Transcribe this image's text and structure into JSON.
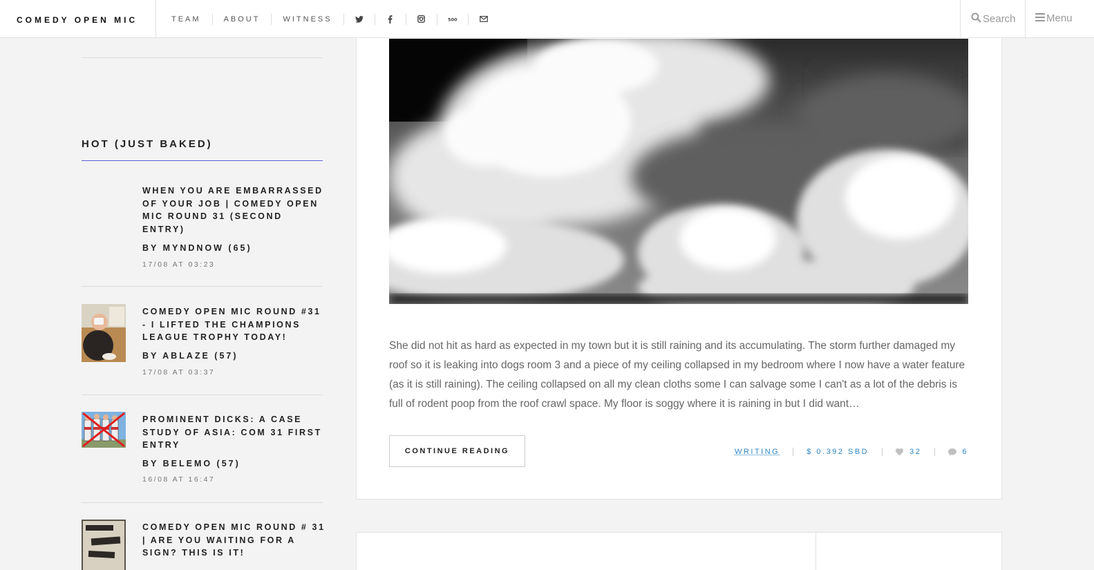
{
  "header": {
    "brand": "COMEDY OPEN MIC",
    "nav": [
      {
        "label": "TEAM"
      },
      {
        "label": "ABOUT"
      },
      {
        "label": "WITNESS"
      }
    ],
    "social_icons": [
      "twitter-icon",
      "facebook-icon",
      "instagram-icon",
      "500px-icon",
      "email-icon"
    ],
    "search_label": "Search",
    "menu_label": "Menu"
  },
  "sidebar": {
    "section_title": "HOT (JUST BAKED)",
    "accent_color": "#5b5fd6",
    "posts": [
      {
        "title": "WHEN YOU ARE EMBARRASSED OF YOUR JOB | COMEDY OPEN MIC ROUND 31 (SECOND ENTRY)",
        "author": "BY MYNDNOW (65)",
        "date": "17/08 AT 03:23",
        "has_thumb": false
      },
      {
        "title": "COMEDY OPEN MIC ROUND #31 - I LIFTED THE CHAMPIONS LEAGUE TROPHY TODAY!",
        "author": "BY ABLAZE (57)",
        "date": "17/08 AT 03:37",
        "has_thumb": true
      },
      {
        "title": "PROMINENT DICKS: A CASE STUDY OF ASIA: COM 31 FIRST ENTRY",
        "author": "BY BELEMO (57)",
        "date": "16/08 AT 16:47",
        "has_thumb": true
      },
      {
        "title": "COMEDY OPEN MIC ROUND # 31 | ARE YOU WAITING FOR A SIGN? THIS IS IT!",
        "author": "",
        "date": "",
        "has_thumb": true
      }
    ]
  },
  "article": {
    "excerpt": "She did not hit as hard as expected in my town but it is still raining and its accumulating. The storm further damaged my roof so it is leaking into dogs room 3 and a piece of my ceiling collapsed in my bedroom where I now have a water feature (as it is still raining). The ceiling collapsed on all my clean cloths some I can salvage some I can't as a lot of the debris is full of rodent poop from the roof crawl space. My floor is soggy where it is raining in but I did want…",
    "continue_label": "CONTINUE READING",
    "tag": "WRITING",
    "payout": "$ 0.392 SBD",
    "likes": "32",
    "comments": "6",
    "link_color": "#2e87c9"
  }
}
